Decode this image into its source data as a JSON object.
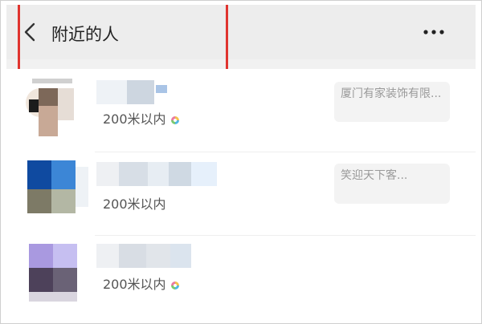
{
  "header": {
    "title": "附近的人",
    "back_icon": "chevron-left-icon",
    "more_icon": "more-horizontal-icon"
  },
  "annotation": {
    "color": "#e0342f"
  },
  "people": [
    {
      "distance": "200米以内",
      "signature": "厦门有家装饰有限...",
      "has_status_ring": true
    },
    {
      "distance": "200米以内",
      "signature": "笑迎天下客...",
      "has_status_ring": false
    },
    {
      "distance": "200米以内",
      "signature": "",
      "has_status_ring": true
    }
  ]
}
